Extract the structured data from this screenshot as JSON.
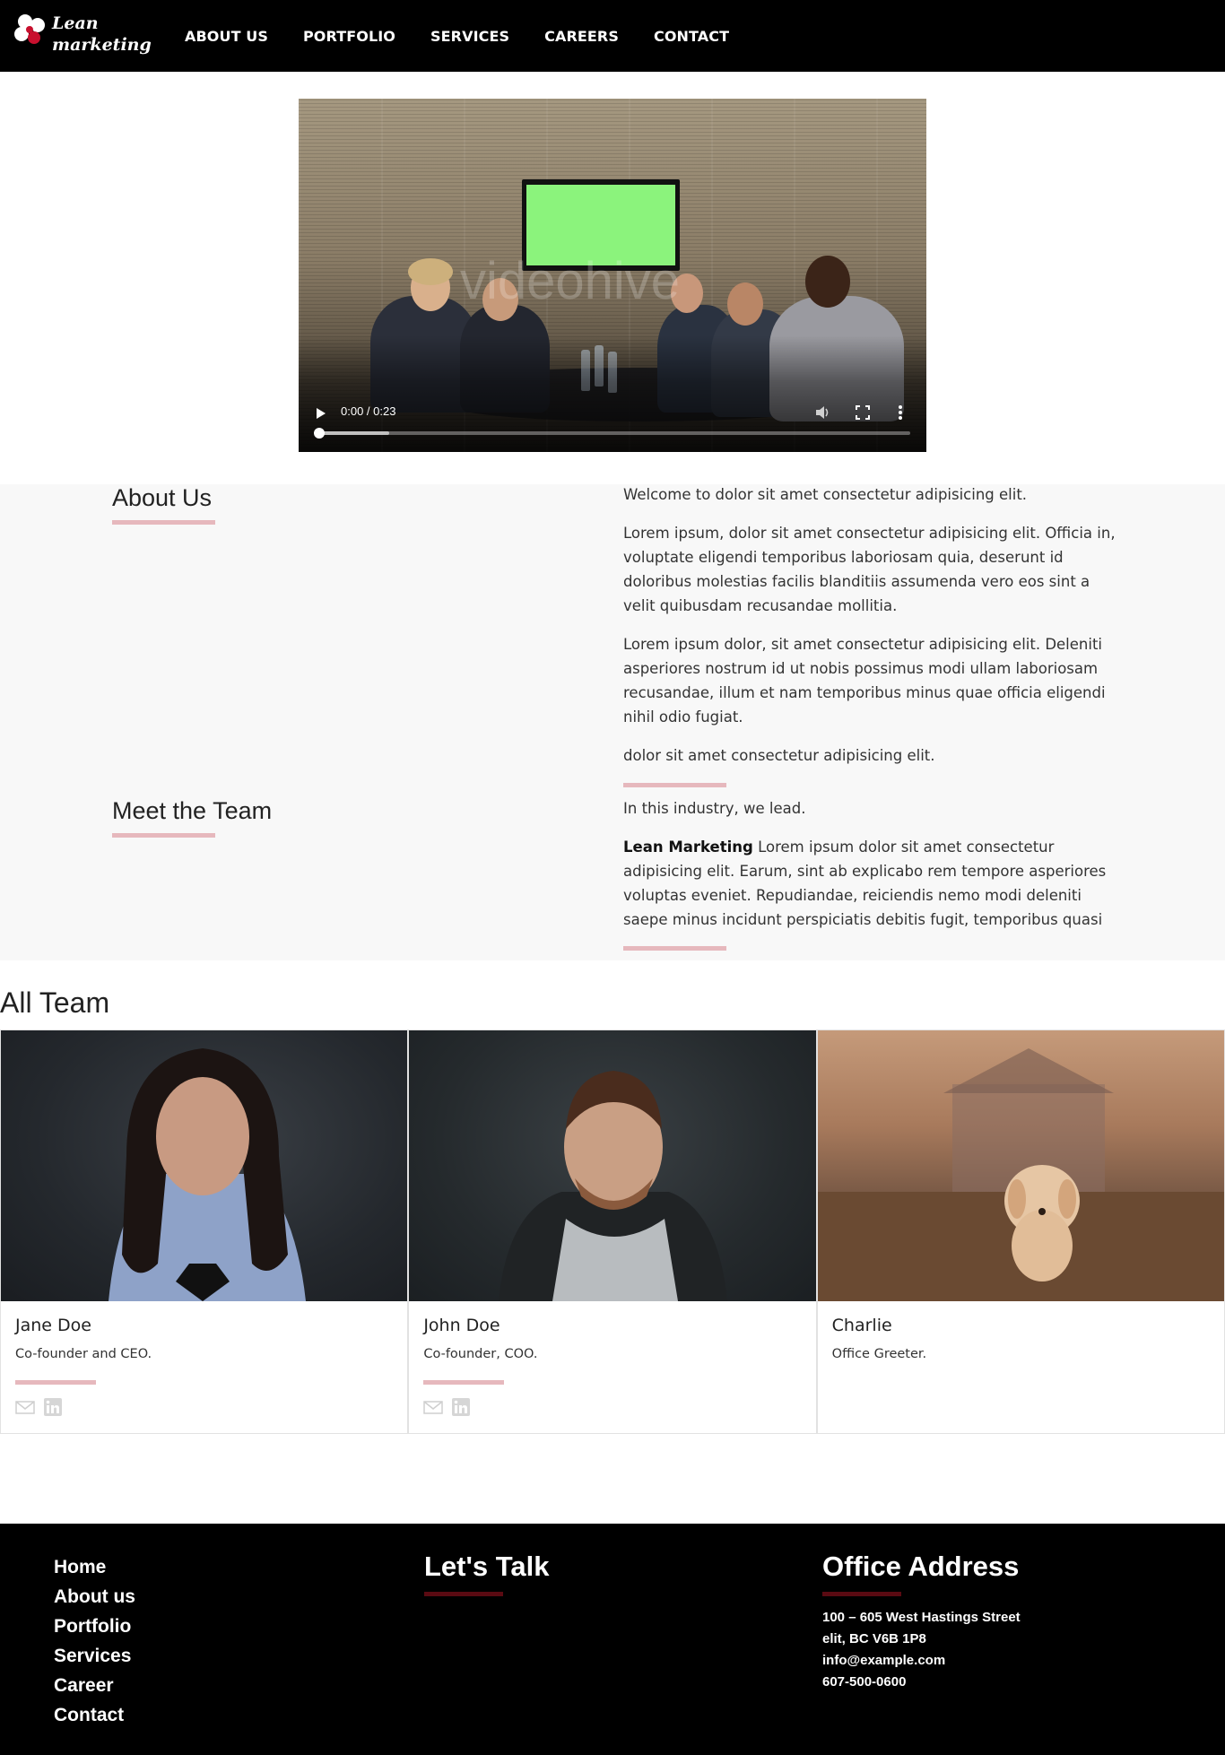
{
  "brand": {
    "line1": "Lean",
    "line2": "marketing"
  },
  "nav": {
    "items": [
      "ABOUT US",
      "PORTFOLIO",
      "SERVICES",
      "CAREERS",
      "CONTACT"
    ]
  },
  "video": {
    "time": "0:00 / 0:23",
    "watermark": "videohive",
    "progress": 0.0,
    "buffered": 0.12
  },
  "about": {
    "title": "About Us",
    "paragraphs": [
      "Welcome to dolor sit amet consectetur adipisicing elit.",
      "Lorem ipsum, dolor sit amet consectetur adipisicing elit. Officia in, voluptate eligendi temporibus laboriosam quia, deserunt id doloribus molestias facilis blanditiis assumenda vero eos sint a velit quibusdam recusandae mollitia.",
      "Lorem ipsum dolor, sit amet consectetur adipisicing elit. Deleniti asperiores nostrum id ut nobis possimus modi ullam laboriosam recusandae, illum et nam temporibus minus quae officia eligendi nihil odio fugiat.",
      "dolor sit amet consectetur adipisicing elit."
    ]
  },
  "team_intro": {
    "title": "Meet the Team",
    "lead": "In this industry, we lead.",
    "company": "Lean Marketing",
    "body": "Lorem ipsum dolor sit amet consectetur adipisicing elit. Earum, sint ab explicabo rem tempore asperiores voluptas eveniet. Repudiandae, reiciendis nemo modi deleniti saepe minus incidunt perspiciatis debitis fugit, temporibus quasi"
  },
  "all_team": {
    "title": "All Team",
    "members": [
      {
        "name": "Jane Doe",
        "role": "Co-founder and CEO."
      },
      {
        "name": "John Doe",
        "role": "Co-founder, COO."
      },
      {
        "name": "Charlie",
        "role": "Office Greeter."
      }
    ]
  },
  "footer": {
    "links": [
      "Home",
      "About us",
      "Portfolio",
      "Services",
      "Career",
      "Contact"
    ],
    "talk_title": "Let's Talk",
    "office_title": "Office Address",
    "address": [
      "100 – 605 West Hastings Street",
      "elit, BC V6B 1P8",
      "info@example.com",
      "607-500-0600"
    ]
  },
  "colors": {
    "accent_bar": "#e6b8bd",
    "footer_accent": "#5a0a12",
    "nav_bg": "#000000",
    "section_bg": "#f8f8f8"
  }
}
